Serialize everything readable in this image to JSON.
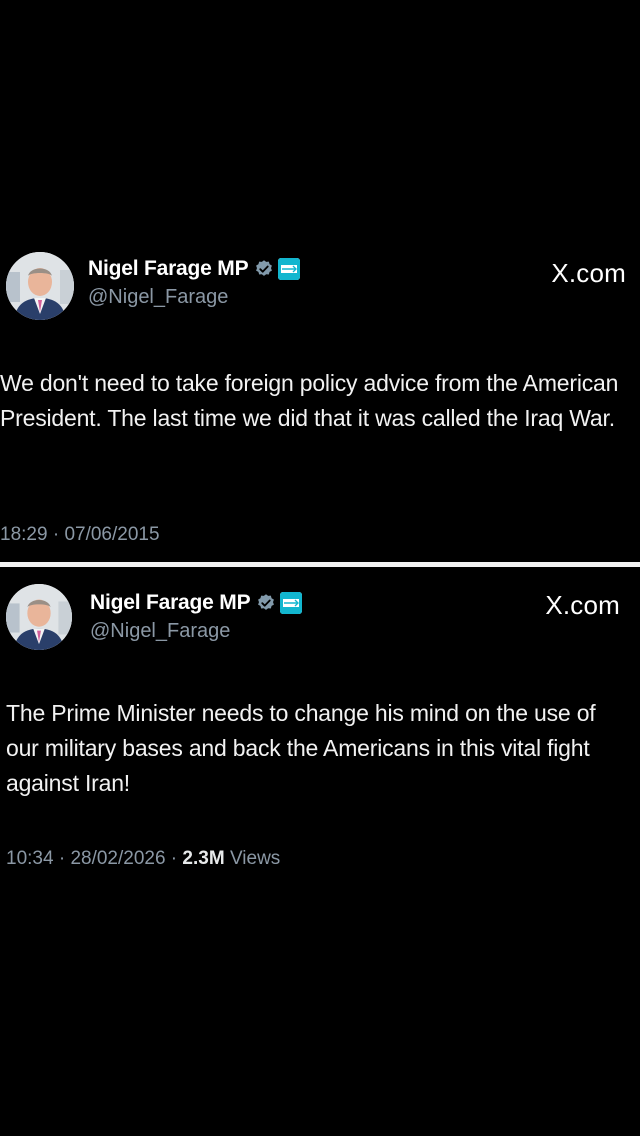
{
  "tweets": [
    {
      "display_name": "Nigel Farage MP",
      "handle": "@Nigel_Farage",
      "brand": "X.com",
      "text": "We don't need to take foreign policy advice from the American President. The last time we did that it was called the Iraq War.",
      "time": "18:29",
      "date": "07/06/2015",
      "separator": " · ",
      "verified_icon": "verified-badge-icon",
      "affiliate_icon": "reform-uk-affiliate-icon"
    },
    {
      "display_name": "Nigel Farage MP",
      "handle": "@Nigel_Farage",
      "brand": "X.com",
      "text": "The Prime Minister needs to change his mind on the use of our military bases and back the Americans in this vital fight against Iran!",
      "time": "10:34",
      "date": "28/02/2026",
      "separator": " · ",
      "views_count": "2.3M",
      "views_label": "Views",
      "verified_icon": "verified-badge-icon",
      "affiliate_icon": "reform-uk-affiliate-icon"
    }
  ],
  "colors": {
    "background": "#000000",
    "text": "#e7e9ea",
    "secondary": "#8b98a5",
    "verified": "#829aab",
    "divider": "#f2f2f2"
  }
}
